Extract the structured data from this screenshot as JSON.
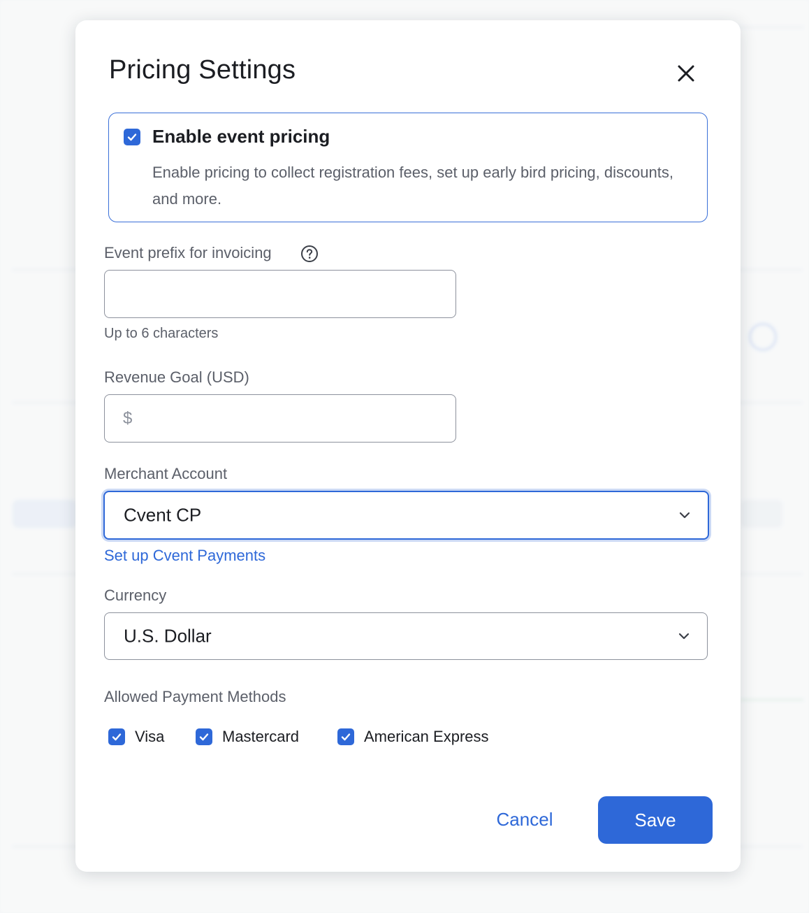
{
  "modal": {
    "title": "Pricing Settings",
    "close_icon": "close-icon"
  },
  "enable_pricing": {
    "checked": true,
    "label": "Enable event pricing",
    "description": "Enable pricing to collect registration fees, set up early bird pricing, discounts, and more."
  },
  "event_prefix": {
    "label": "Event prefix for invoicing",
    "help_icon": "question-circle-icon",
    "value": "",
    "placeholder": "",
    "hint": "Up to 6 characters"
  },
  "revenue_goal": {
    "label": "Revenue Goal (USD)",
    "value": "",
    "placeholder": "$"
  },
  "merchant_account": {
    "label": "Merchant Account",
    "selected": "Cvent CP",
    "chevron_icon": "chevron-down-icon",
    "setup_link": "Set up Cvent Payments"
  },
  "currency": {
    "label": "Currency",
    "selected": "U.S. Dollar",
    "chevron_icon": "chevron-down-icon"
  },
  "payment_methods": {
    "label": "Allowed Payment Methods",
    "items": [
      {
        "label": "Visa",
        "checked": true
      },
      {
        "label": "Mastercard",
        "checked": true
      },
      {
        "label": "American Express",
        "checked": true
      }
    ]
  },
  "footer": {
    "cancel_label": "Cancel",
    "save_label": "Save"
  },
  "colors": {
    "accent": "#2e68d8",
    "border": "#8c919c",
    "muted_text": "#5b5f69"
  }
}
